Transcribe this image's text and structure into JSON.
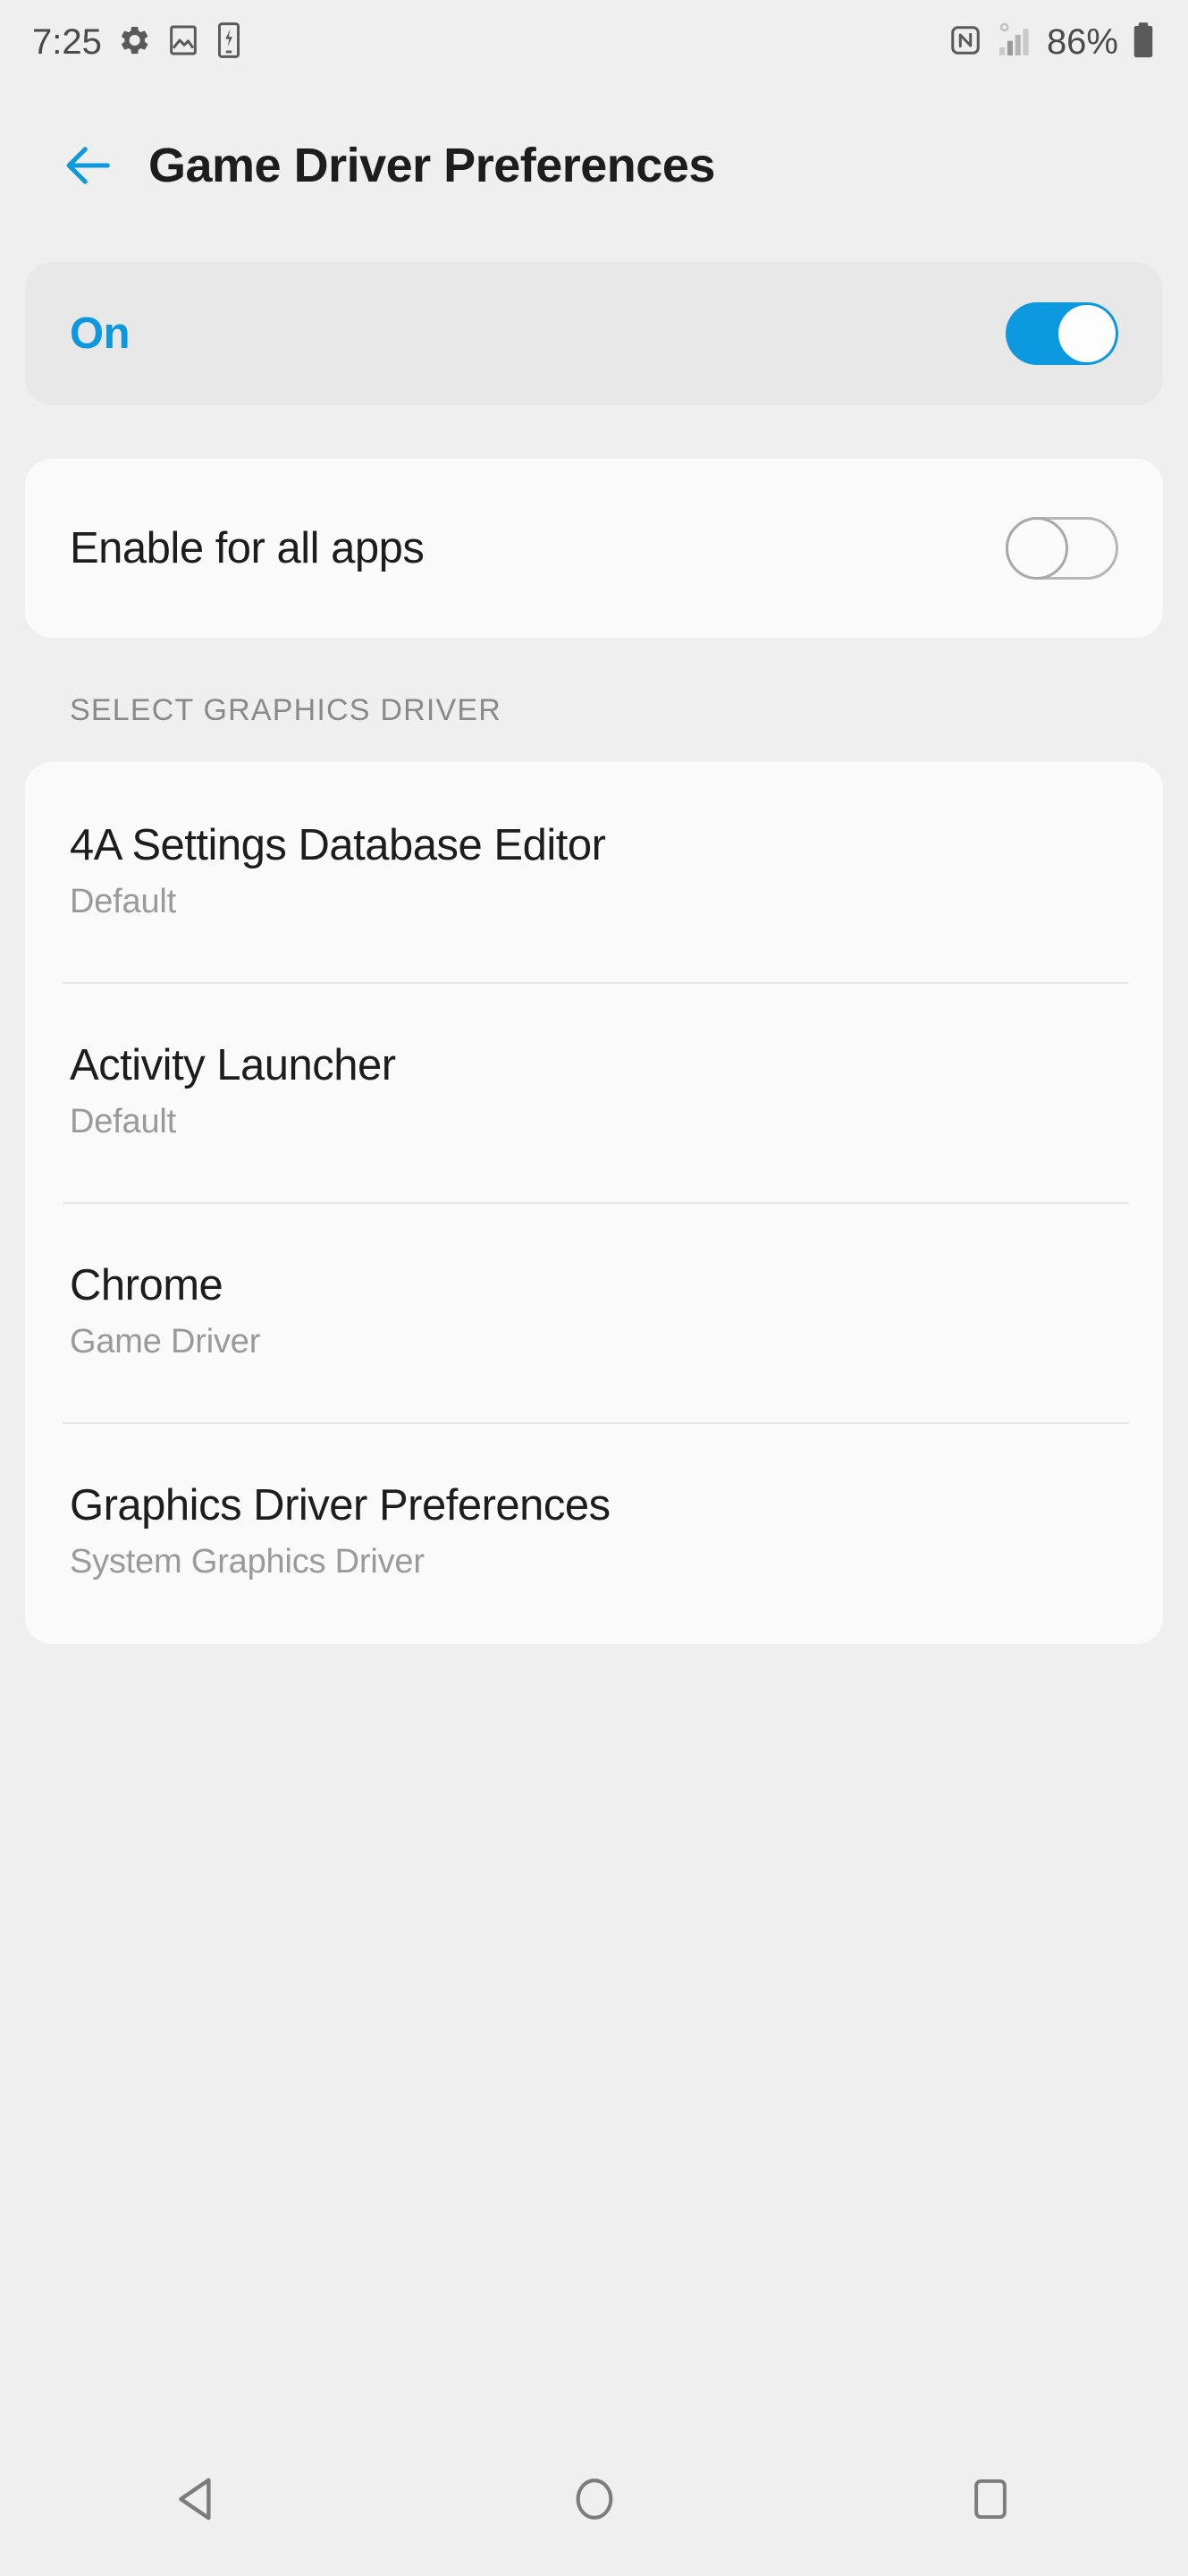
{
  "status_bar": {
    "time": "7:25",
    "battery_percent": "86%",
    "left_icons": [
      "gear-icon",
      "image-icon",
      "phone-charging-icon"
    ],
    "right_icons": [
      "nfc-icon",
      "signal-bars-icon",
      "battery-icon"
    ],
    "icon_color": "#5a5a5a"
  },
  "app_bar": {
    "back_label": "back-arrow",
    "title": "Game Driver Preferences",
    "accent_color": "#0d99e0"
  },
  "master_switch": {
    "label": "On",
    "state": "on",
    "track_color": "#0d99e0"
  },
  "all_apps": {
    "label": "Enable for all apps",
    "state": "off"
  },
  "section": {
    "header": "SELECT GRAPHICS DRIVER"
  },
  "drivers": [
    {
      "name": "4A Settings Database Editor",
      "value": "Default"
    },
    {
      "name": "Activity Launcher",
      "value": "Default"
    },
    {
      "name": "Chrome",
      "value": "Game Driver"
    },
    {
      "name": "Graphics Driver Preferences",
      "value": "System Graphics Driver"
    }
  ],
  "nav_bar": {
    "back": "back-triangle-icon",
    "home": "home-circle-icon",
    "recents": "recents-square-icon",
    "icon_color": "#7c7c7c"
  }
}
